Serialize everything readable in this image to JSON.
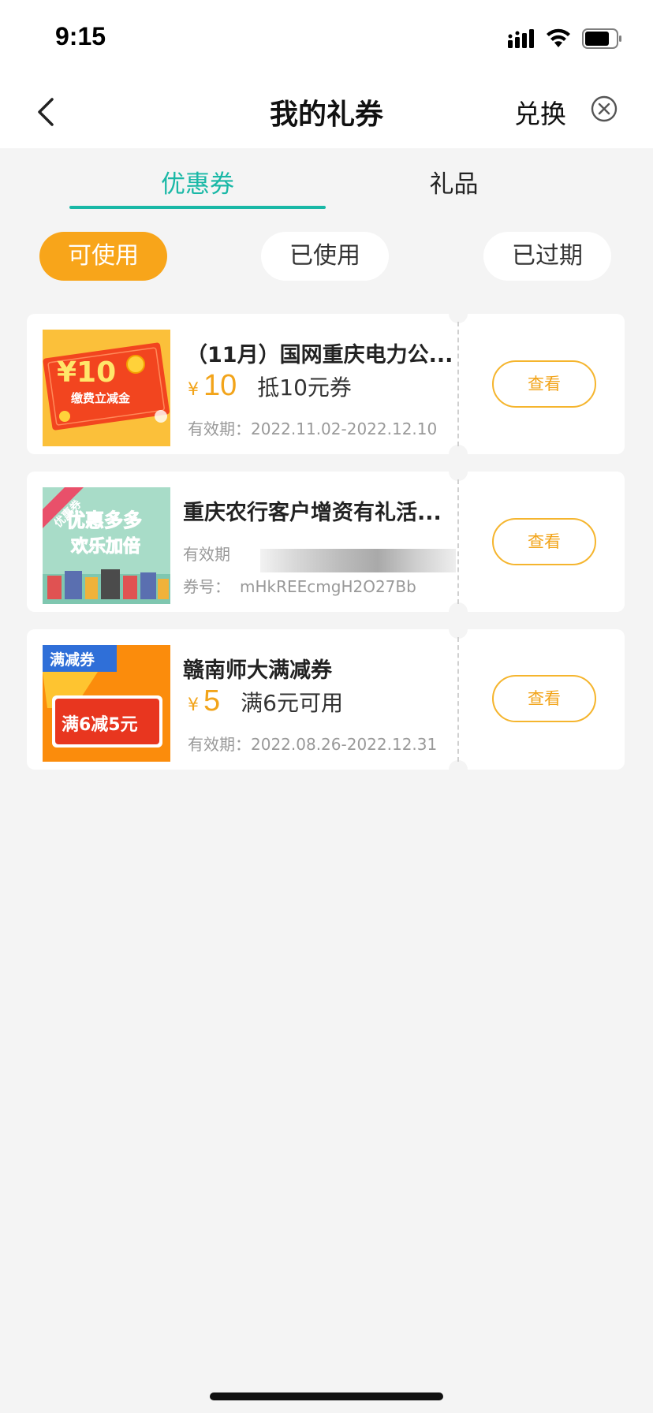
{
  "status_bar": {
    "time": "9:15"
  },
  "nav": {
    "title": "我的礼券",
    "redeem_label": "兑换"
  },
  "tabs": [
    {
      "label": "优惠券",
      "active": true
    },
    {
      "label": "礼品",
      "active": false
    }
  ],
  "filters": [
    {
      "label": "可使用",
      "active": true
    },
    {
      "label": "已使用",
      "active": false
    },
    {
      "label": "已过期",
      "active": false
    }
  ],
  "coupons": [
    {
      "title": "（11月）国网重庆电力公...",
      "currency": "¥",
      "amount": "10",
      "desc": "抵10元券",
      "validity": "有效期：2022.11.02-2022.12.10",
      "button": "查看",
      "thumb": {
        "big_text": "¥10",
        "small_text": "缴费立减金"
      }
    },
    {
      "title": "重庆农行客户增资有礼活...",
      "validity_label": "有效期",
      "code_label": "券号：",
      "code": "mHkREEcmgH2O27Bb",
      "button": "查看",
      "thumb": {
        "ribbon": "优惠券",
        "line1": "优惠多多",
        "line2": "欢乐加倍"
      }
    },
    {
      "title": "赣南师大满减券",
      "currency": "¥",
      "amount": "5",
      "desc": "满6元可用",
      "validity": "有效期：2022.08.26-2022.12.31",
      "button": "查看",
      "thumb": {
        "tag": "满减券",
        "text": "满6减5元"
      }
    }
  ],
  "colors": {
    "accent_teal": "#19b8a6",
    "accent_orange": "#f8a51a",
    "price_orange": "#f2a41a",
    "page_bg": "#f4f4f4"
  }
}
